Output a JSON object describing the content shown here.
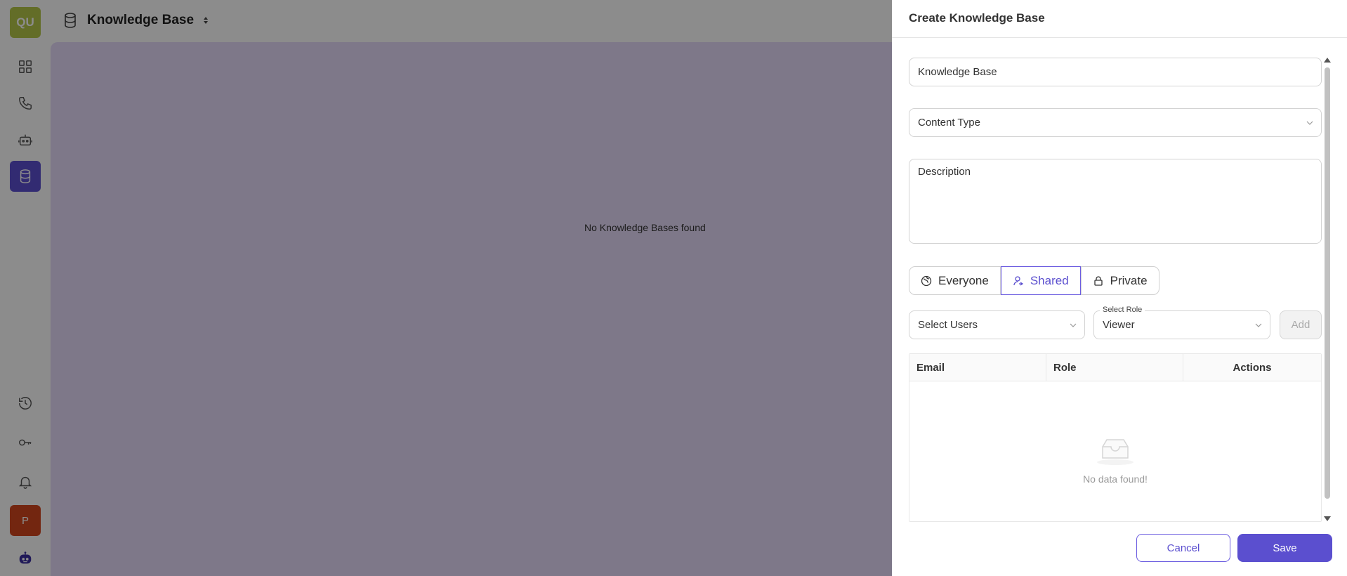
{
  "sidebar": {
    "org_badge": "QU",
    "user_badge": "P",
    "items": [
      {
        "icon": "dashboard-icon"
      },
      {
        "icon": "phone-icon"
      },
      {
        "icon": "bot-icon"
      },
      {
        "icon": "database-icon",
        "active": true
      },
      {
        "icon": "history-icon"
      },
      {
        "icon": "key-icon"
      },
      {
        "icon": "bell-icon"
      },
      {
        "icon": "robot-logo-icon"
      }
    ]
  },
  "header": {
    "title": "Knowledge Base"
  },
  "main": {
    "empty_message": "No Knowledge Bases found"
  },
  "drawer": {
    "title": "Create Knowledge Base",
    "name_field": {
      "value": "Knowledge Base"
    },
    "content_type_field": {
      "value": "Content Type"
    },
    "description_field": {
      "value": "Description"
    },
    "access": {
      "options": [
        "Everyone",
        "Shared",
        "Private"
      ],
      "selected": "Shared"
    },
    "select_users": {
      "value": "Select Users"
    },
    "select_role": {
      "label": "Select Role",
      "value": "Viewer"
    },
    "add_button": "Add",
    "table": {
      "columns": [
        "Email",
        "Role",
        "Actions"
      ],
      "empty_text": "No data found!"
    },
    "cancel_button": "Cancel",
    "save_button": "Save"
  },
  "colors": {
    "accent": "#5b4fcf",
    "org_badge": "#b5c64a",
    "user_badge": "#d2451e",
    "main_bg": "#e5dbf9"
  }
}
